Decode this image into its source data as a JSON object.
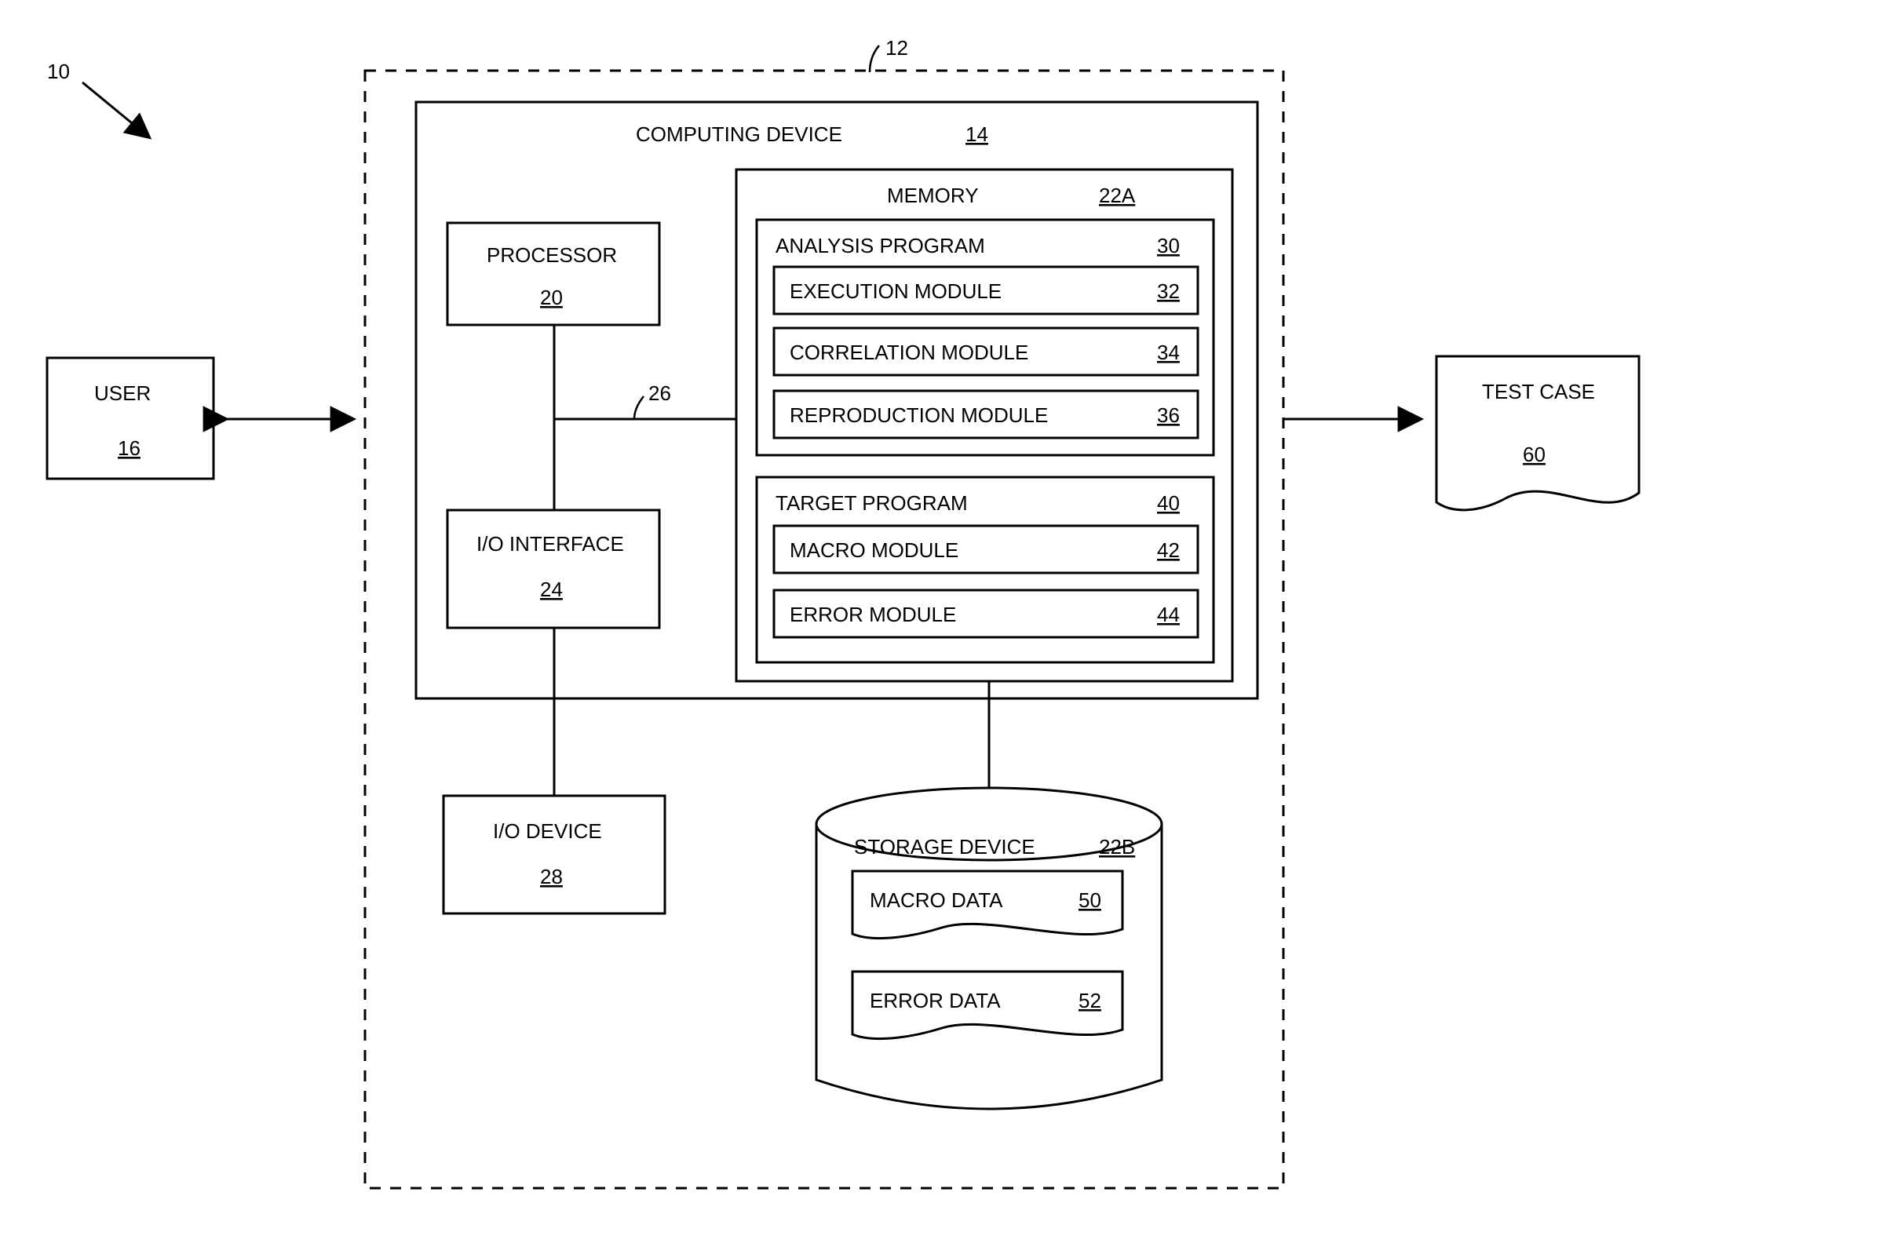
{
  "diagram": {
    "ref_overall": "10",
    "boundary_ref": "12",
    "user": {
      "label": "USER",
      "ref": "16"
    },
    "device": {
      "label": "COMPUTING DEVICE",
      "ref": "14"
    },
    "processor": {
      "label": "PROCESSOR",
      "ref": "20"
    },
    "bus_ref": "26",
    "io_if": {
      "label": "I/O INTERFACE",
      "ref": "24"
    },
    "io_dev": {
      "label": "I/O DEVICE",
      "ref": "28"
    },
    "memory": {
      "label": "MEMORY",
      "ref": "22A"
    },
    "analysis": {
      "label": "ANALYSIS PROGRAM",
      "ref": "30",
      "modules": [
        {
          "label": "EXECUTION MODULE",
          "ref": "32"
        },
        {
          "label": "CORRELATION MODULE",
          "ref": "34"
        },
        {
          "label": "REPRODUCTION MODULE",
          "ref": "36"
        }
      ]
    },
    "target": {
      "label": "TARGET PROGRAM",
      "ref": "40",
      "modules": [
        {
          "label": "MACRO MODULE",
          "ref": "42"
        },
        {
          "label": "ERROR MODULE",
          "ref": "44"
        }
      ]
    },
    "storage": {
      "label": "STORAGE DEVICE",
      "ref": "22B",
      "items": [
        {
          "label": "MACRO DATA",
          "ref": "50"
        },
        {
          "label": "ERROR DATA",
          "ref": "52"
        }
      ]
    },
    "testcase": {
      "label": "TEST CASE",
      "ref": "60"
    }
  }
}
